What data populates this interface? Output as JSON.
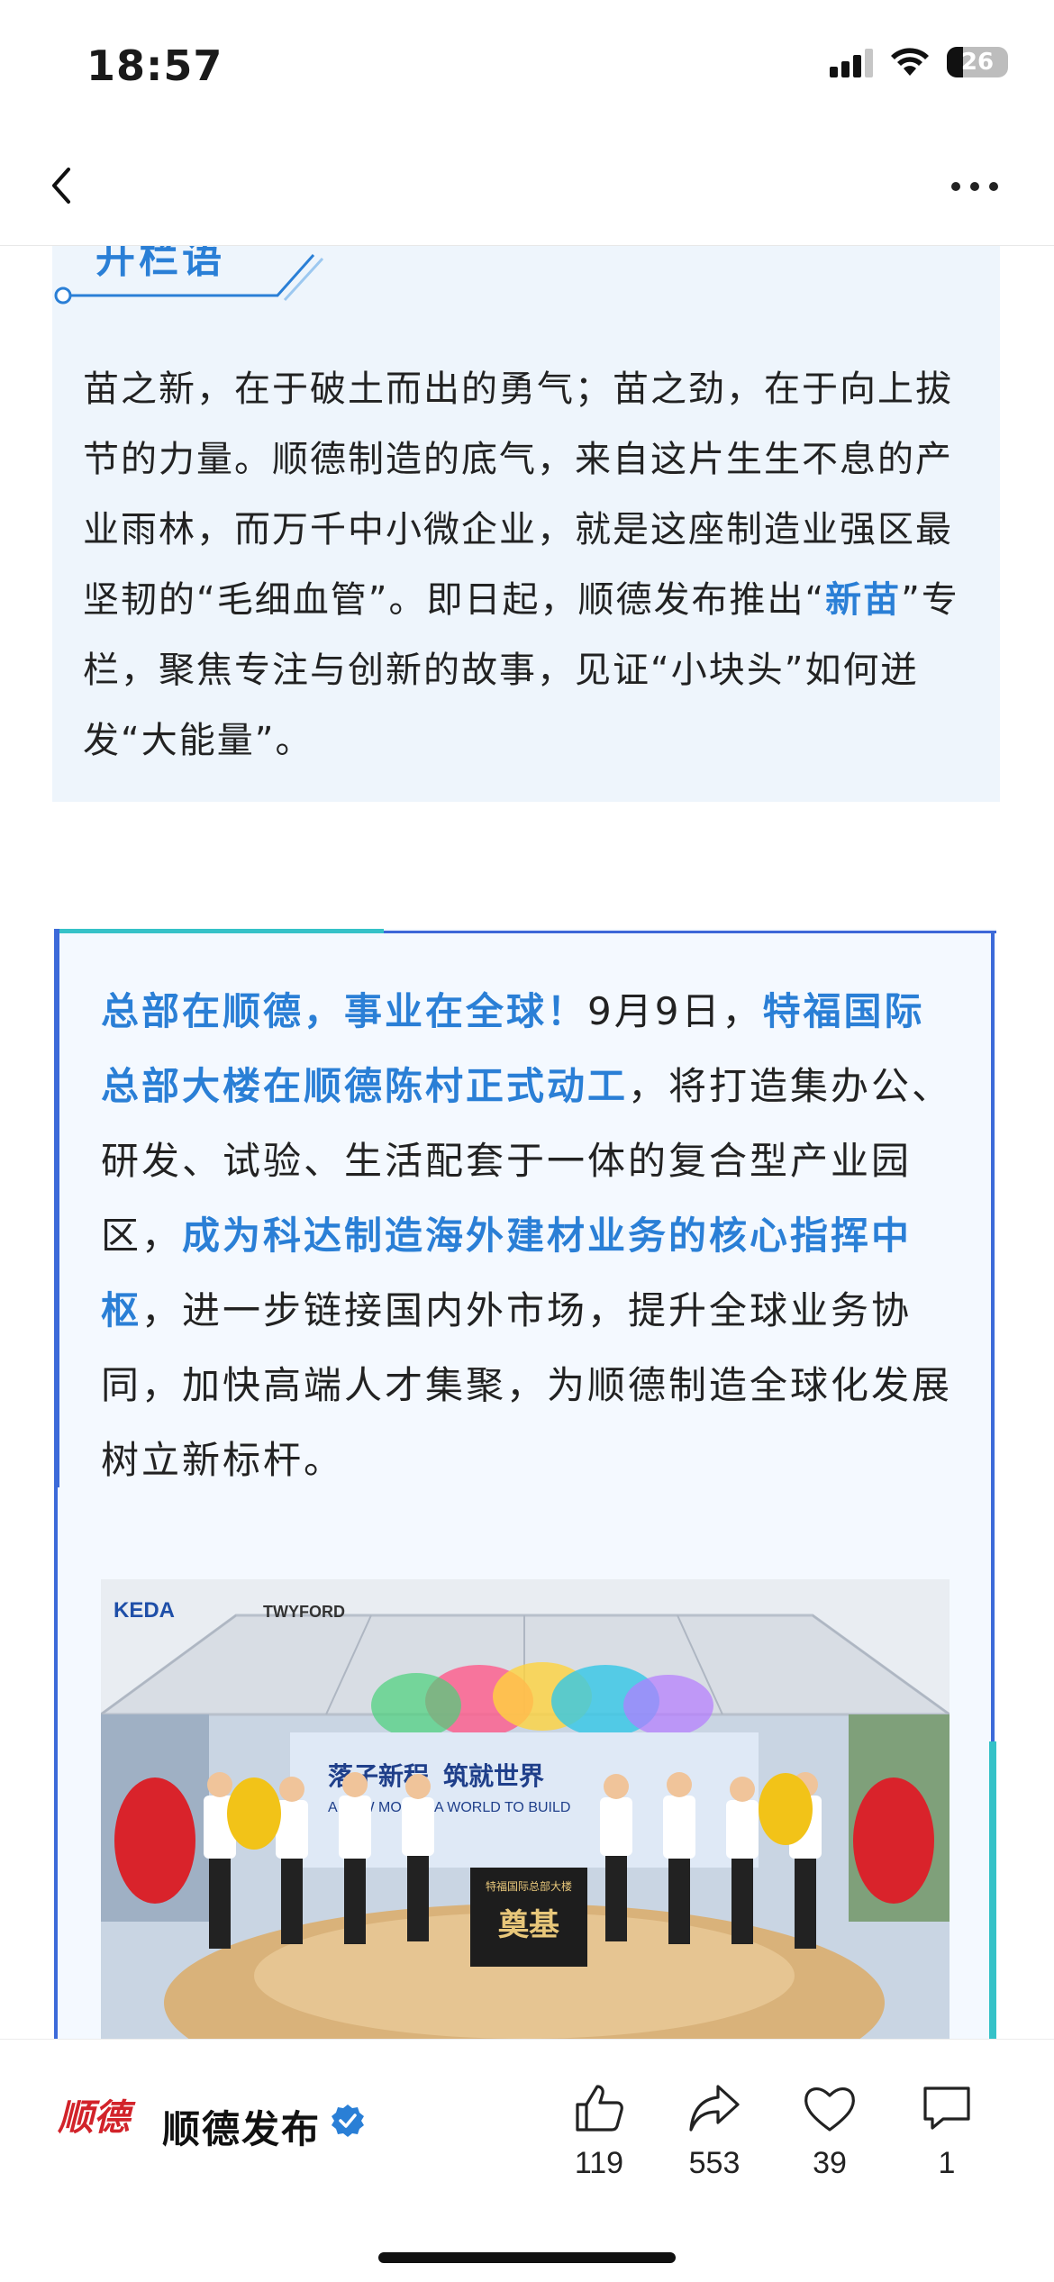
{
  "status_bar": {
    "time": "18:57",
    "battery": "26",
    "icons": [
      "signal-icon",
      "wifi-icon",
      "battery-icon"
    ]
  },
  "nav": {
    "back_icon": "back-chevron-icon",
    "more_icon": "more-dots-icon"
  },
  "intro": {
    "tag": "开栏语",
    "paragraph": [
      {
        "text": "苗之新，在于破土而出的勇气；苗之劲，在于向上拔节的力量。顺德制造的底气，来自这片生生不息的产业雨林，而万千中小微企业，就是这座制造业强区最坚韧的“毛细血管”。即日起，顺德发布推出“",
        "highlight": false
      },
      {
        "text": "新苗",
        "highlight": true
      },
      {
        "text": "”专栏，聚焦专注与创新的故事，见证“小块头”如何迸发“大能量”。",
        "highlight": false
      }
    ]
  },
  "news": {
    "paragraph": [
      {
        "text": "总部在顺德，事业在全球！",
        "highlight": true
      },
      {
        "text": "9月9日，",
        "highlight": false
      },
      {
        "text": "特福国际总部大楼在顺德陈村正式动工",
        "highlight": true
      },
      {
        "text": "，将打造集办公、研发、试验、生活配套于一体的复合型产业园区，",
        "highlight": false
      },
      {
        "text": "成为科达制造海外建材业务的核心指挥中枢",
        "highlight": true
      },
      {
        "text": "，进一步链接国内外市场，提升全球业务协同，加快高端人才集聚，为顺德制造全球化发展树立新标杆。",
        "highlight": false
      }
    ],
    "photo": {
      "brand_left": "KEDA",
      "brand_right": "TWYFORD",
      "stage_title_cn_1": "落子新程",
      "stage_title_cn_2": "筑就世界",
      "stage_title_en_1": "A NEW MOVE",
      "stage_title_en_2": "A WORLD TO BUILD",
      "stone_title": "特福国际总部大楼",
      "stone_main": "奠基"
    }
  },
  "bottom_bar": {
    "account_name": "顺德发布",
    "account_logo_text": "顺德",
    "actions": [
      {
        "name": "like",
        "icon": "thumbs-up-icon",
        "count": "119"
      },
      {
        "name": "share",
        "icon": "share-icon",
        "count": "553"
      },
      {
        "name": "favorite",
        "icon": "heart-icon",
        "count": "39"
      },
      {
        "name": "comment",
        "icon": "comment-icon",
        "count": "1"
      }
    ]
  }
}
